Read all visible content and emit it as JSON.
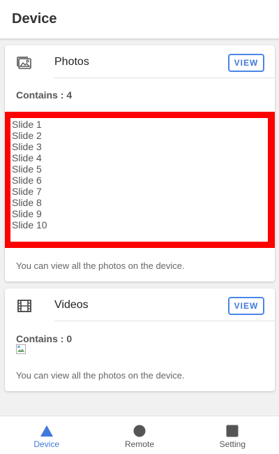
{
  "app": {
    "title": "Device"
  },
  "photos_card": {
    "title": "Photos",
    "view_label": "VIEW",
    "contains_text": "Contains : 4",
    "slides": [
      "Slide 1",
      "Slide 2",
      "Slide 3",
      "Slide 4",
      "Slide 5",
      "Slide 6",
      "Slide 7",
      "Slide 8",
      "Slide 9",
      "Slide 10"
    ],
    "description": "You can view all the photos on the device."
  },
  "videos_card": {
    "title": "Videos",
    "view_label": "VIEW",
    "contains_text": "Contains : 0",
    "description": "You can view all the photos on the device."
  },
  "bottom_nav": {
    "items": [
      {
        "label": "Device",
        "icon": "triangle-icon",
        "active": true
      },
      {
        "label": "Remote",
        "icon": "circle-icon",
        "active": false
      },
      {
        "label": "Setting",
        "icon": "square-icon",
        "active": false
      }
    ]
  },
  "colors": {
    "accent": "#3f79db",
    "highlight_border": "#ff0000"
  }
}
